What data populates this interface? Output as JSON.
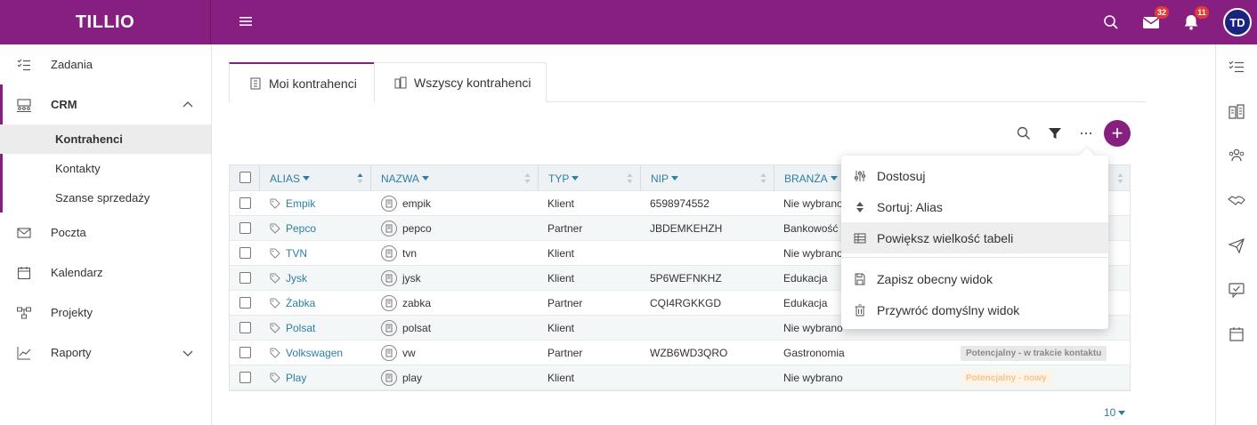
{
  "app": {
    "brand": "TILLIO",
    "mail_count": "32",
    "notif_count": "11",
    "avatar_initials": "TD",
    "accent": "#861f7f"
  },
  "sidebar": {
    "items": [
      {
        "label": "Zadania",
        "icon": "checklist-icon"
      },
      {
        "label": "CRM",
        "icon": "crm-icon"
      },
      {
        "label": "Poczta",
        "icon": "mail-icon"
      },
      {
        "label": "Kalendarz",
        "icon": "calendar-icon"
      },
      {
        "label": "Projekty",
        "icon": "projects-icon"
      },
      {
        "label": "Raporty",
        "icon": "chart-icon"
      }
    ],
    "crm_sub": [
      "Kontrahenci",
      "Kontakty",
      "Szanse sprzedaży"
    ]
  },
  "tabs": [
    "Moi kontrahenci",
    "Wszyscy kontrahenci"
  ],
  "table": {
    "headers": [
      "ALIAS",
      "NAZWA",
      "TYP",
      "NIP",
      "BRANŻA"
    ],
    "rows": [
      {
        "alias": "Empik",
        "nazwa": "empik",
        "typ": "Klient",
        "nip": "6598974552",
        "branza": "Nie wybrano",
        "status": ""
      },
      {
        "alias": "Pepco",
        "nazwa": "pepco",
        "typ": "Partner",
        "nip": "JBDEMKEHZH",
        "branza": "Bankowość",
        "status": ""
      },
      {
        "alias": "TVN",
        "nazwa": "tvn",
        "typ": "Klient",
        "nip": "",
        "branza": "Nie wybrano",
        "status": ""
      },
      {
        "alias": "Jysk",
        "nazwa": "jysk",
        "typ": "Klient",
        "nip": "5P6WEFNKHZ",
        "branza": "Edukacja",
        "status": ""
      },
      {
        "alias": "Żabka",
        "nazwa": "zabka",
        "typ": "Partner",
        "nip": "CQI4RGKKGD",
        "branza": "Edukacja",
        "status": ""
      },
      {
        "alias": "Polsat",
        "nazwa": "polsat",
        "typ": "Klient",
        "nip": "",
        "branza": "Nie wybrano",
        "status": ""
      },
      {
        "alias": "Volkswagen",
        "nazwa": "vw",
        "typ": "Partner",
        "nip": "WZB6WD3QRO",
        "branza": "Gastronomia",
        "status": "Potencjalny - w trakcie kontaktu"
      },
      {
        "alias": "Play",
        "nazwa": "play",
        "typ": "Klient",
        "nip": "",
        "branza": "Nie wybrano",
        "status": "Potencjalny - nowy"
      }
    ]
  },
  "pager": {
    "per_page": "10"
  },
  "menu": {
    "items": [
      "Dostosuj",
      "Sortuj: Alias",
      "Powiększ wielkość tabeli",
      "Zapisz obecny widok",
      "Przywróć domyślny widok"
    ]
  }
}
